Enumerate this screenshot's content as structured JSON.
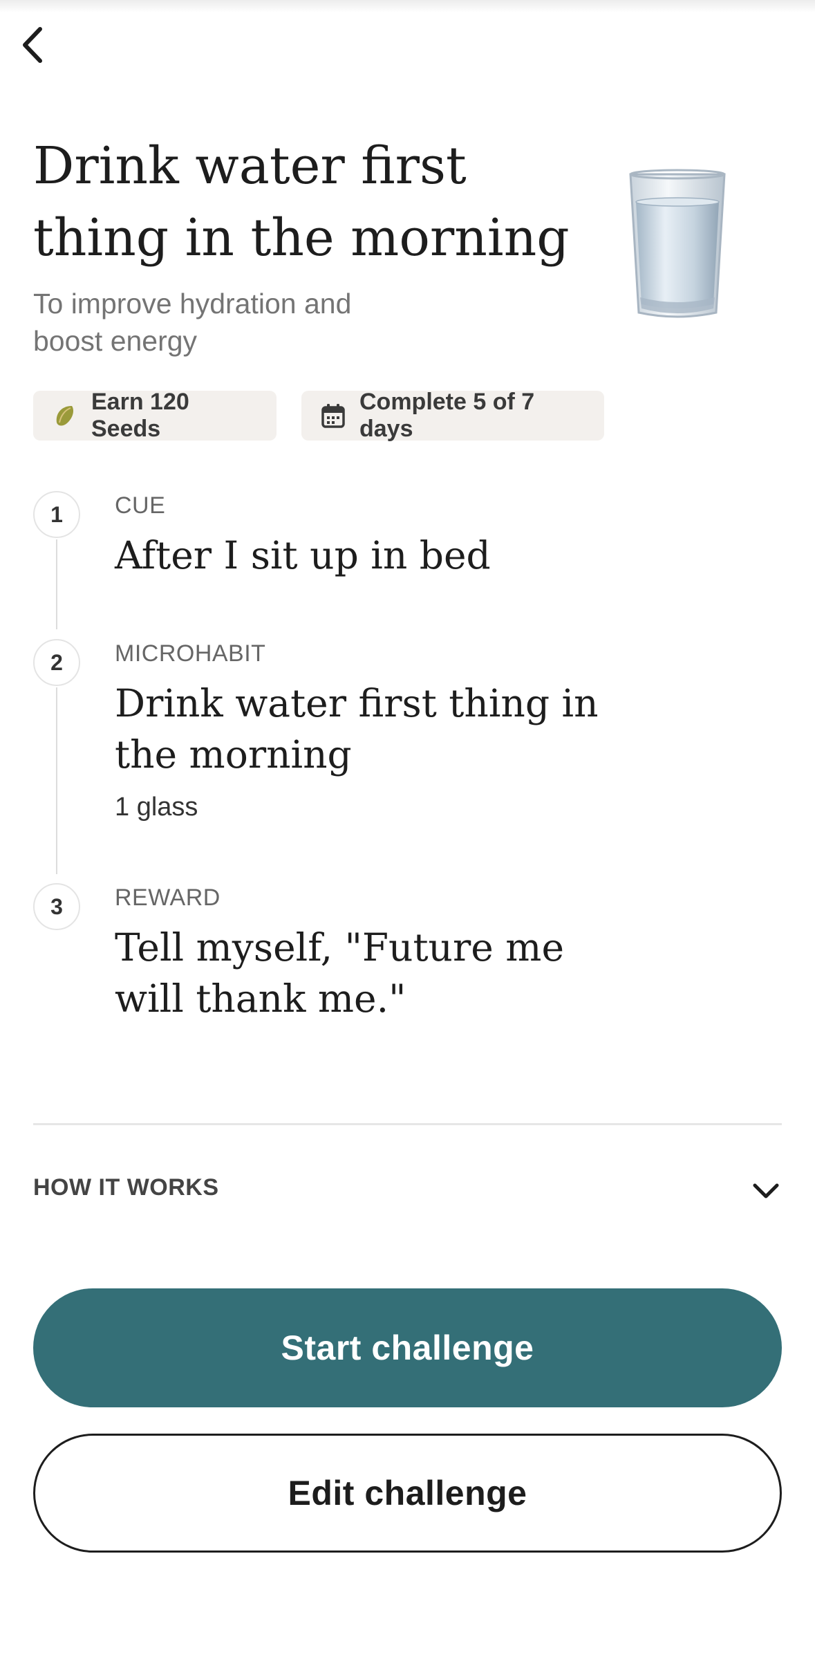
{
  "header": {
    "back_icon": "chevron-left-icon"
  },
  "challenge": {
    "title": "Drink water first thing in the morning",
    "subtitle": "To improve hydration and boost energy",
    "image": "water-glass-illustration"
  },
  "chips": {
    "seeds_label": "Earn 120 Seeds",
    "seeds_icon": "seed-icon",
    "days_label": "Complete 5 of 7 days",
    "days_icon": "calendar-icon"
  },
  "steps": [
    {
      "number": "1",
      "label": "CUE",
      "text": "After I sit up in bed",
      "sub": ""
    },
    {
      "number": "2",
      "label": "MICROHABIT",
      "text": "Drink water first thing in the morning",
      "sub": "1 glass"
    },
    {
      "number": "3",
      "label": "REWARD",
      "text": "Tell myself, \"Future me will thank me.\"",
      "sub": ""
    }
  ],
  "how_it_works": {
    "label": "HOW IT WORKS",
    "icon": "chevron-down-icon"
  },
  "actions": {
    "start_label": "Start challenge",
    "edit_label": "Edit challenge"
  },
  "colors": {
    "accent": "#346f77",
    "chip_bg": "#f3f0ed",
    "text_primary": "#1d1d1d",
    "text_secondary": "#747474"
  }
}
